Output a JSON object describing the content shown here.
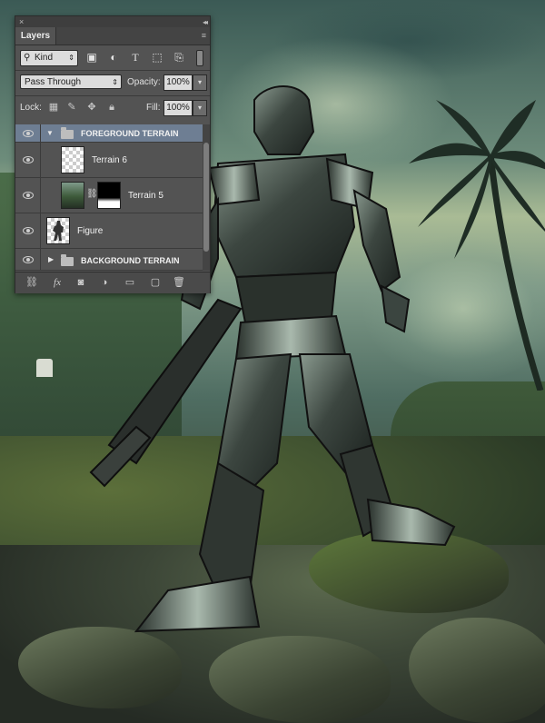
{
  "panel": {
    "close_glyph": "×",
    "collapse_glyph": "◂◂",
    "tab_label": "Layers",
    "menu_glyph": "≡"
  },
  "filter": {
    "kind_label": "Kind",
    "icons": [
      "image-filter-icon",
      "adjustment-filter-icon",
      "type-filter-icon",
      "shape-filter-icon",
      "smart-object-filter-icon"
    ]
  },
  "blend": {
    "mode": "Pass Through",
    "opacity_label": "Opacity:",
    "opacity_value": "100%"
  },
  "lock": {
    "label": "Lock:",
    "fill_label": "Fill:",
    "fill_value": "100%"
  },
  "layers": [
    {
      "name": "FOREGROUND TERRAIN",
      "type": "group",
      "expanded": true,
      "selected": true,
      "visible": true
    },
    {
      "name": "Terrain 6",
      "type": "layer",
      "visible": true
    },
    {
      "name": "Terrain 5",
      "type": "layer-with-mask",
      "visible": true
    },
    {
      "name": "Figure",
      "type": "layer",
      "visible": true
    },
    {
      "name": "BACKGROUND TERRAIN",
      "type": "group",
      "expanded": false,
      "visible": true
    }
  ],
  "bottom_icons": [
    "link-layers-icon",
    "fx-icon",
    "add-mask-icon",
    "new-adjustment-icon",
    "new-group-icon",
    "new-layer-icon",
    "delete-layer-icon"
  ],
  "colors": {
    "panel_bg": "#535353",
    "selection": "#6e7e93"
  }
}
